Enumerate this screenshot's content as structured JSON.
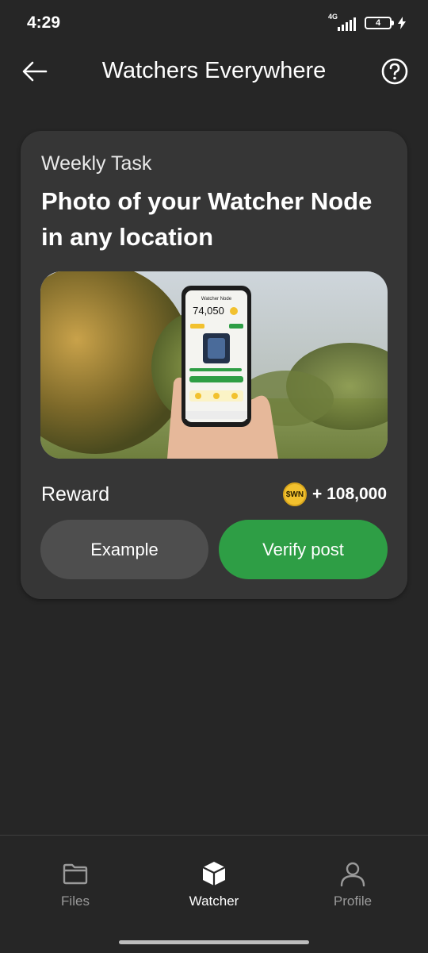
{
  "status_bar": {
    "time": "4:29",
    "network": "4G",
    "battery": "4"
  },
  "header": {
    "title": "Watchers Everywhere",
    "back_icon": "arrow-left-icon",
    "help_icon": "question-circle-icon"
  },
  "task": {
    "type": "Weekly Task",
    "title": "Photo of your Watcher Node in any location",
    "image": {
      "phone_header": "Watcher Node",
      "phone_balance": "74,050"
    },
    "reward_label": "Reward",
    "coin_label": "$WN",
    "reward_amount": "+ 108,000",
    "example_button": "Example",
    "verify_button": "Verify post"
  },
  "nav": {
    "items": [
      {
        "label": "Files",
        "icon": "folder-icon",
        "active": false
      },
      {
        "label": "Watcher",
        "icon": "cube-icon",
        "active": true
      },
      {
        "label": "Profile",
        "icon": "user-icon",
        "active": false
      }
    ]
  },
  "colors": {
    "background": "#262626",
    "card": "#363636",
    "accent_green": "#2e9e45",
    "coin": "#f2c12e"
  }
}
